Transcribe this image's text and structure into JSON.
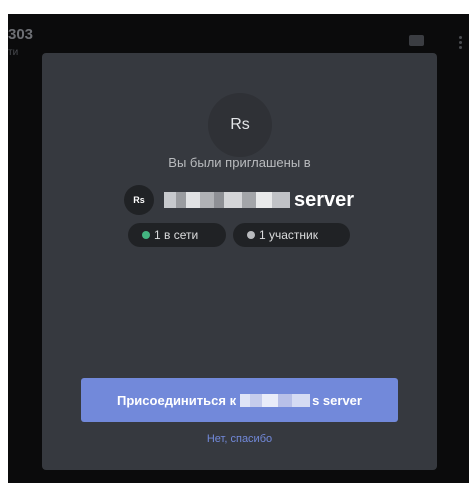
{
  "background": {
    "title": "303",
    "subtitle": "ти",
    "chat_icon": "chat-bubble-icon",
    "kebab_icon": "kebab-menu-icon"
  },
  "modal": {
    "server_avatar_initials": "Rs",
    "invite_label": "Вы были приглашены в",
    "server_small_avatar_initials": "Rs",
    "server_name_suffix": "server",
    "online_count": "1 в сети",
    "member_count": "1 участник",
    "online_dot_color": "#43b581",
    "member_dot_color": "#b9bbbe",
    "join_button_prefix": "Присоединиться к",
    "join_button_suffix": "s server",
    "decline_label": "Нет, спасибо",
    "accent_color": "#7289da"
  }
}
